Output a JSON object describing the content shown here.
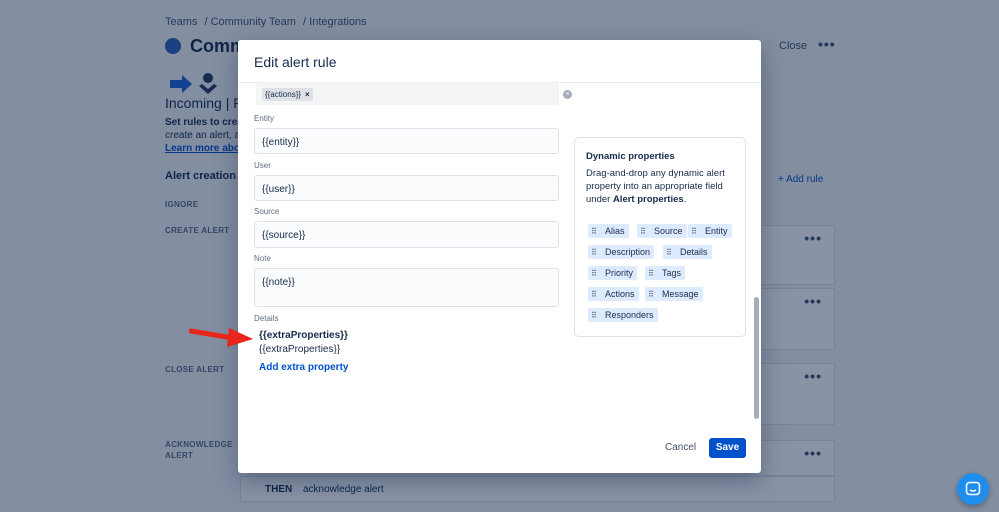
{
  "background": {
    "breadcrumbs": [
      "Teams",
      "/ Community Team",
      "/ Integrations"
    ],
    "team_title": "Commu",
    "close_label": "Close",
    "integration_title": "Incoming | Ru",
    "rules_desc_bold": "Set rules to crea",
    "rules_desc_line2": "create an alert, ac",
    "learn_more": "Learn more abou",
    "alert_rules_heading": "Alert creation r",
    "sections": {
      "ignore": "IGNORE",
      "create": "CREATE ALERT",
      "close": "CLOSE ALERT",
      "acknowledge_1": "ACKNOWLEDGE",
      "acknowledge_2": "ALERT"
    },
    "add_rule": "Add rule",
    "then_label": "THEN",
    "then_action": "acknowledge alert"
  },
  "modal": {
    "title": "Edit alert rule",
    "actions_tag": "{{actions}}",
    "fields": {
      "entity": {
        "label": "Entity",
        "value": "{{entity}}"
      },
      "user": {
        "label": "User",
        "value": "{{user}}"
      },
      "source": {
        "label": "Source",
        "value": "{{source}}"
      },
      "note": {
        "label": "Note",
        "value": "{{note}}"
      }
    },
    "details": {
      "label": "Details",
      "key": "{{extraProperties}}",
      "value": "{{extraProperties}}",
      "add_property": "Add extra property"
    },
    "dynamic": {
      "title": "Dynamic properties",
      "desc_part1": "Drag-and-drop any dynamic alert property into an appropriate field under ",
      "desc_bold": "Alert properties",
      "desc_end": ".",
      "chips": [
        "Alias",
        "Source",
        "Entity",
        "Description",
        "Details",
        "Priority",
        "Tags",
        "Actions",
        "Message",
        "Responders"
      ]
    },
    "cancel_label": "Cancel",
    "save_label": "Save"
  },
  "colors": {
    "primary": "#0052cc",
    "chip_bg": "#deebff",
    "arrow": "#e8261c",
    "chat": "#1f8ded"
  }
}
